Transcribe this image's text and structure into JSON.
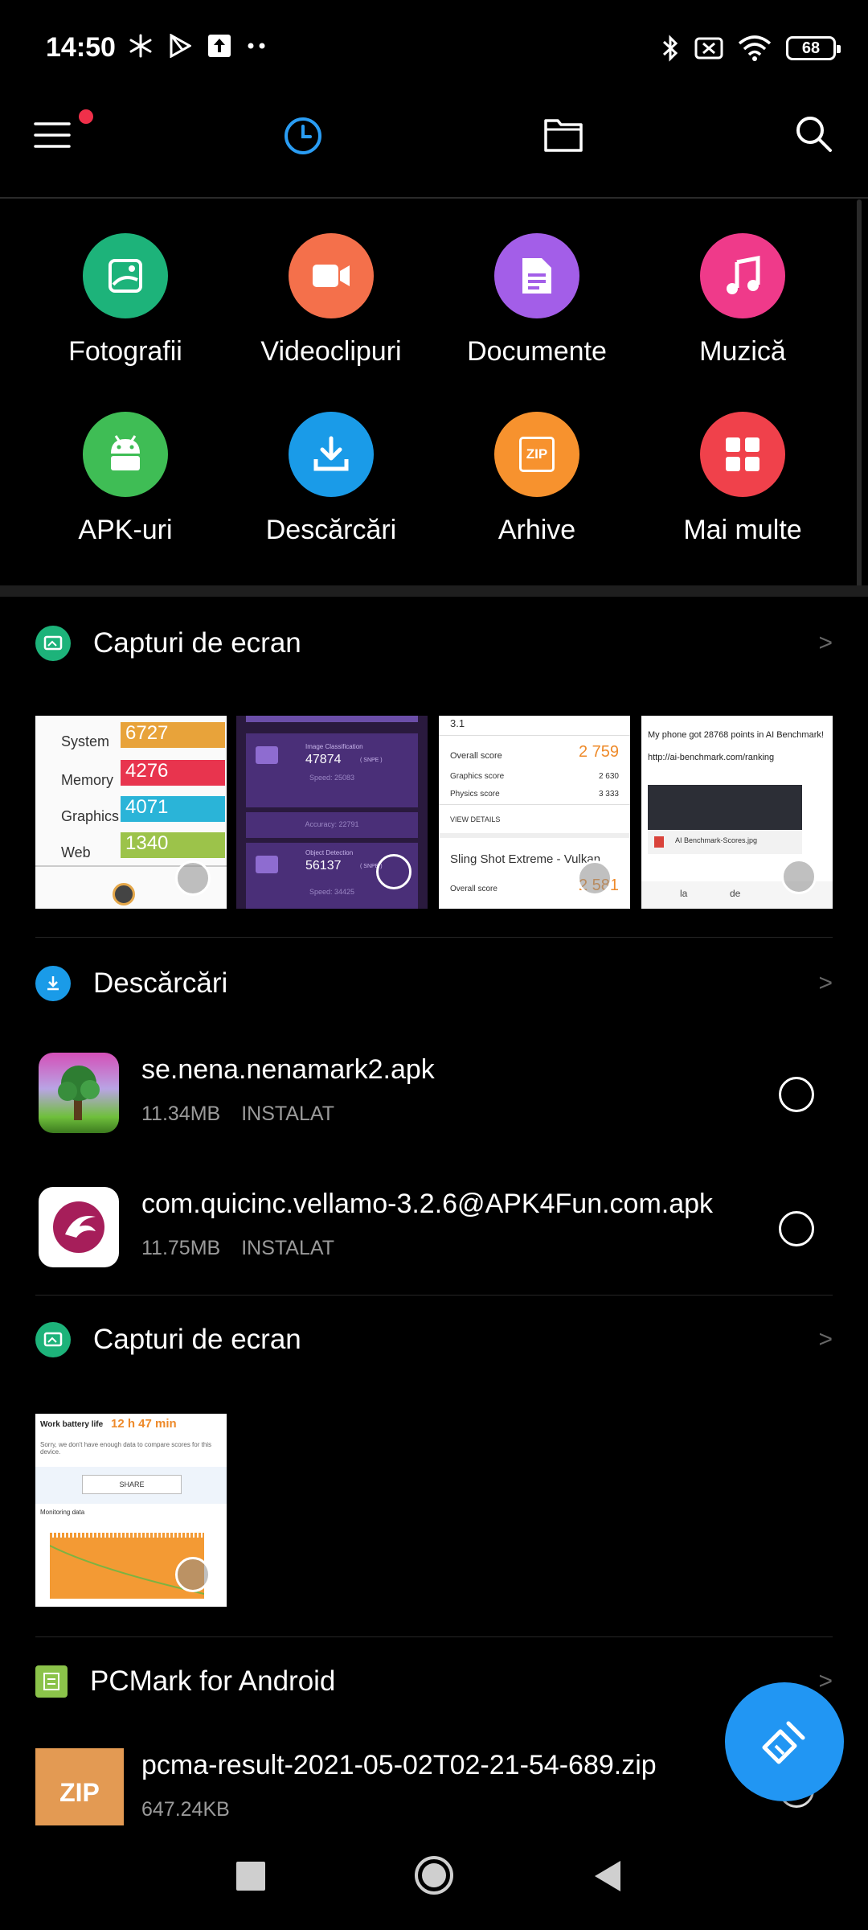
{
  "status_bar": {
    "time": "14:50",
    "battery": "68"
  },
  "categories": [
    {
      "label": "Fotografii",
      "color": "#1db37a",
      "icon": "image-icon"
    },
    {
      "label": "Videoclipuri",
      "color": "#f4704b",
      "icon": "video-icon"
    },
    {
      "label": "Documente",
      "color": "#a35ee8",
      "icon": "document-icon"
    },
    {
      "label": "Muzică",
      "color": "#ef3a8a",
      "icon": "music-icon"
    },
    {
      "label": "APK-uri",
      "color": "#3fbd55",
      "icon": "android-icon"
    },
    {
      "label": "Descărcări",
      "color": "#1a9be8",
      "icon": "download-icon"
    },
    {
      "label": "Arhive",
      "color": "#f7922e",
      "icon": "zip-icon",
      "icon_text": "ZIP"
    },
    {
      "label": "Mai multe",
      "color": "#f0414b",
      "icon": "grid-icon"
    }
  ],
  "sections": {
    "screenshots1": {
      "title": "Capturi de ecran",
      "thumb1": {
        "rows": [
          {
            "label": "System",
            "value": "6727"
          },
          {
            "label": "Memory",
            "value": "4276"
          },
          {
            "label": "Graphics",
            "value": "4071"
          },
          {
            "label": "Web",
            "value": "1340"
          }
        ]
      },
      "thumb2": {
        "image_class": "Image Classification",
        "image_score": "47874",
        "image_unit": "( SNPE )",
        "speed1": "Speed: 25083",
        "accuracy": "Accuracy: 22791",
        "object_det": "Object Detection",
        "object_score": "56137",
        "object_unit": "( SNPE )",
        "speed2": "Speed: 34425"
      },
      "thumb3": {
        "top": "3.1",
        "overall": "Overall score",
        "overall_v": "2 759",
        "graphics": "Graphics score",
        "graphics_v": "2 630",
        "physics": "Physics score",
        "physics_v": "3 333",
        "view": "VIEW DETAILS",
        "title2": "Sling Shot Extreme - Vulkan",
        "overall2": "Overall score",
        "overall2_v": "2 581"
      },
      "thumb4": {
        "line1": "My phone got 28768 points in AI Benchmark!",
        "url": "http://ai-benchmark.com/ranking",
        "file": "AI Benchmark-Scores.jpg",
        "kb1": "la",
        "kb2": "de"
      }
    },
    "downloads": {
      "title": "Descărcări",
      "files": [
        {
          "name": "se.nena.nenamark2.apk",
          "size": "11.34MB",
          "status": "INSTALAT"
        },
        {
          "name": "com.quicinc.vellamo-3.2.6@APK4Fun.com.apk",
          "size": "11.75MB",
          "status": "INSTALAT"
        }
      ]
    },
    "screenshots2": {
      "title": "Capturi de ecran",
      "thumb": {
        "label": "Work battery life",
        "value": "12 h 47 min",
        "note": "Sorry, we don't have enough data to compare scores for this device.",
        "share": "SHARE",
        "monitor": "Monitoring data"
      }
    },
    "pcmark": {
      "title": "PCMark for Android",
      "file": {
        "name": "pcma-result-2021-05-02T02-21-54-689.zip",
        "size": "647.24KB",
        "icon_text": "ZIP"
      }
    }
  }
}
